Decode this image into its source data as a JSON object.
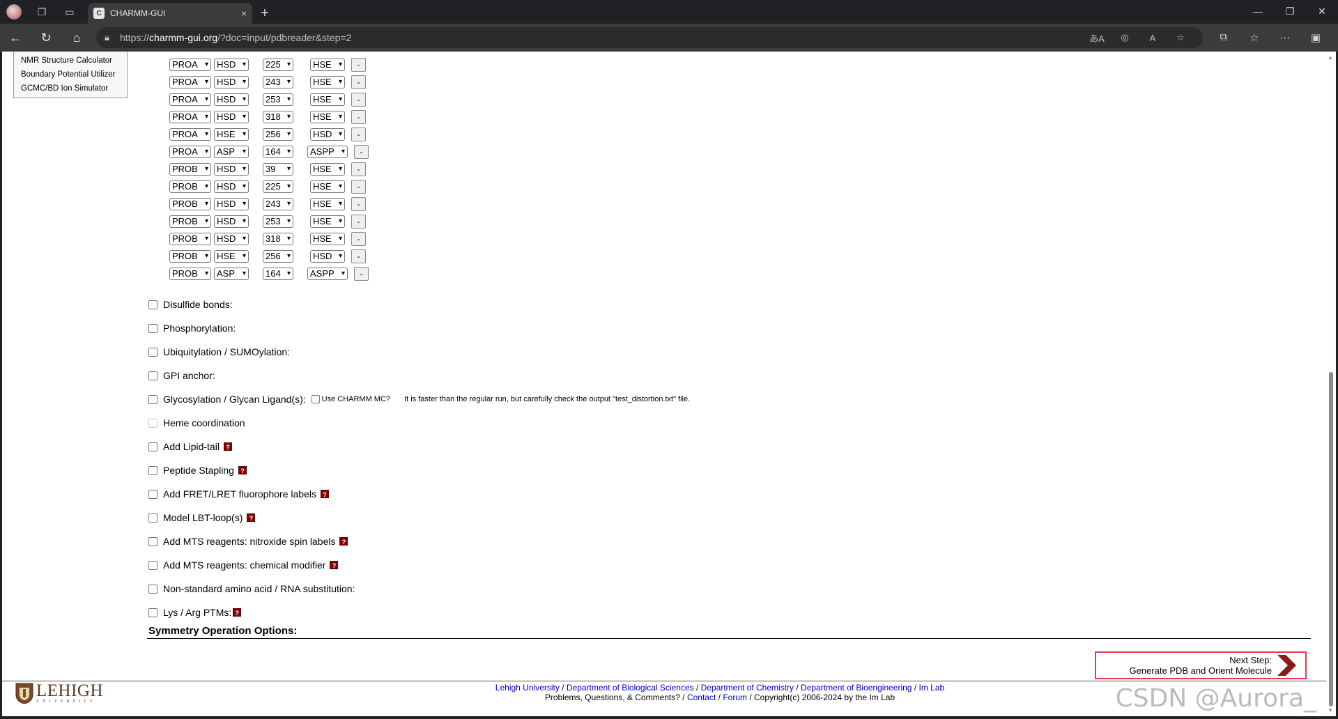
{
  "browser": {
    "tab_title": "CHARMM-GUI",
    "tab_close": "×",
    "new_tab": "+",
    "url_prefix": "https://",
    "url_host": "charmm-gui.org",
    "url_path": "/?doc=input/pdbreader&step=2",
    "window_controls": [
      "—",
      "❐",
      "✕"
    ]
  },
  "leftmenu": {
    "items": [
      "NMR Structure Calculator",
      "Boundary Potential Utilizer",
      "GCMC/BD Ion Simulator"
    ]
  },
  "residues": [
    {
      "segment": "PROA",
      "residue": "HSD",
      "number": "225",
      "new": "HSE"
    },
    {
      "segment": "PROA",
      "residue": "HSD",
      "number": "243",
      "new": "HSE"
    },
    {
      "segment": "PROA",
      "residue": "HSD",
      "number": "253",
      "new": "HSE"
    },
    {
      "segment": "PROA",
      "residue": "HSD",
      "number": "318",
      "new": "HSE"
    },
    {
      "segment": "PROA",
      "residue": "HSE",
      "number": "256",
      "new": "HSD"
    },
    {
      "segment": "PROA",
      "residue": "ASP",
      "number": "164",
      "new": "ASPP"
    },
    {
      "segment": "PROB",
      "residue": "HSD",
      "number": "39",
      "new": "HSE"
    },
    {
      "segment": "PROB",
      "residue": "HSD",
      "number": "225",
      "new": "HSE"
    },
    {
      "segment": "PROB",
      "residue": "HSD",
      "number": "243",
      "new": "HSE"
    },
    {
      "segment": "PROB",
      "residue": "HSD",
      "number": "253",
      "new": "HSE"
    },
    {
      "segment": "PROB",
      "residue": "HSD",
      "number": "318",
      "new": "HSE"
    },
    {
      "segment": "PROB",
      "residue": "HSE",
      "number": "256",
      "new": "HSD"
    },
    {
      "segment": "PROB",
      "residue": "ASP",
      "number": "164",
      "new": "ASPP"
    }
  ],
  "remove_label": "-",
  "options": {
    "disulfide": "Disulfide bonds:",
    "phosphorylation": "Phosphorylation:",
    "ubiquitylation": "Ubiquitylation / SUMOylation:",
    "gpi": "GPI anchor:",
    "glycosylation": "Glycosylation / Glycan Ligand(s):",
    "use_charmm_mc": "Use CHARMM MC?",
    "mc_hint": "It is faster than the regular run, but carefully check the output \"test_distortion.txt\" file.",
    "heme": "Heme coordination",
    "lipid_tail": "Add Lipid-tail",
    "stapling": "Peptide Stapling",
    "fret": "Add FRET/LRET fluorophore labels",
    "lbt": "Model LBT-loop(s)",
    "mts_spin": "Add MTS reagents: nitroxide spin labels",
    "mts_chem": "Add MTS reagents: chemical modifier",
    "nonstandard": "Non-standard amino acid / RNA substitution:",
    "lys_arg": "Lys / Arg PTMs:"
  },
  "help_glyph": "?",
  "symmetry_title": "Symmetry Operation Options:",
  "next_step": {
    "line1": "Next Step:",
    "line2": "Generate PDB and Orient Molecule"
  },
  "footer": {
    "logo_word": "LEHIGH",
    "logo_sub": "UNIVERSITY",
    "links": [
      "Lehigh University",
      "Department of Biological Sciences",
      "Department of Chemistry",
      "Department of Bioengineering",
      "Im Lab"
    ],
    "line2_prefix": "Problems, Questions, & Comments? /",
    "contact": "Contact",
    "forum": "Forum",
    "copyright": "/ Copyright(c) 2006-2024 by the Im Lab"
  },
  "watermark": "CSDN @Aurora_",
  "colors": {
    "highlight_border": "#e8384f",
    "help_icon": "#8b0000",
    "link": "#0000cc",
    "next_arrow": "#8b1a1a"
  }
}
